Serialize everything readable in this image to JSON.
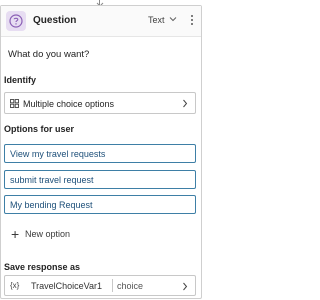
{
  "node": {
    "title": "Question",
    "type_select": "Text",
    "question_text": "What do you want?"
  },
  "identify": {
    "label": "Identify",
    "value": "Multiple choice options"
  },
  "options": {
    "label": "Options for user",
    "items": [
      "View my travel requests",
      "submit travel request",
      "My bending Request"
    ],
    "new_option": "New option"
  },
  "save": {
    "label": "Save response as",
    "variable": "TravelChoiceVar1",
    "type": "choice",
    "var_icon": "{x}"
  },
  "colors": {
    "accent": "#3e7fa6",
    "option_text": "#1d4f79",
    "question_icon": "#8a5fb5",
    "question_icon_bg": "#e7ddf2"
  },
  "icons": [
    "question-icon",
    "chevron-down-icon",
    "more-icon",
    "grid-icon",
    "chevron-right-icon",
    "plus-icon",
    "variable-icon"
  ]
}
